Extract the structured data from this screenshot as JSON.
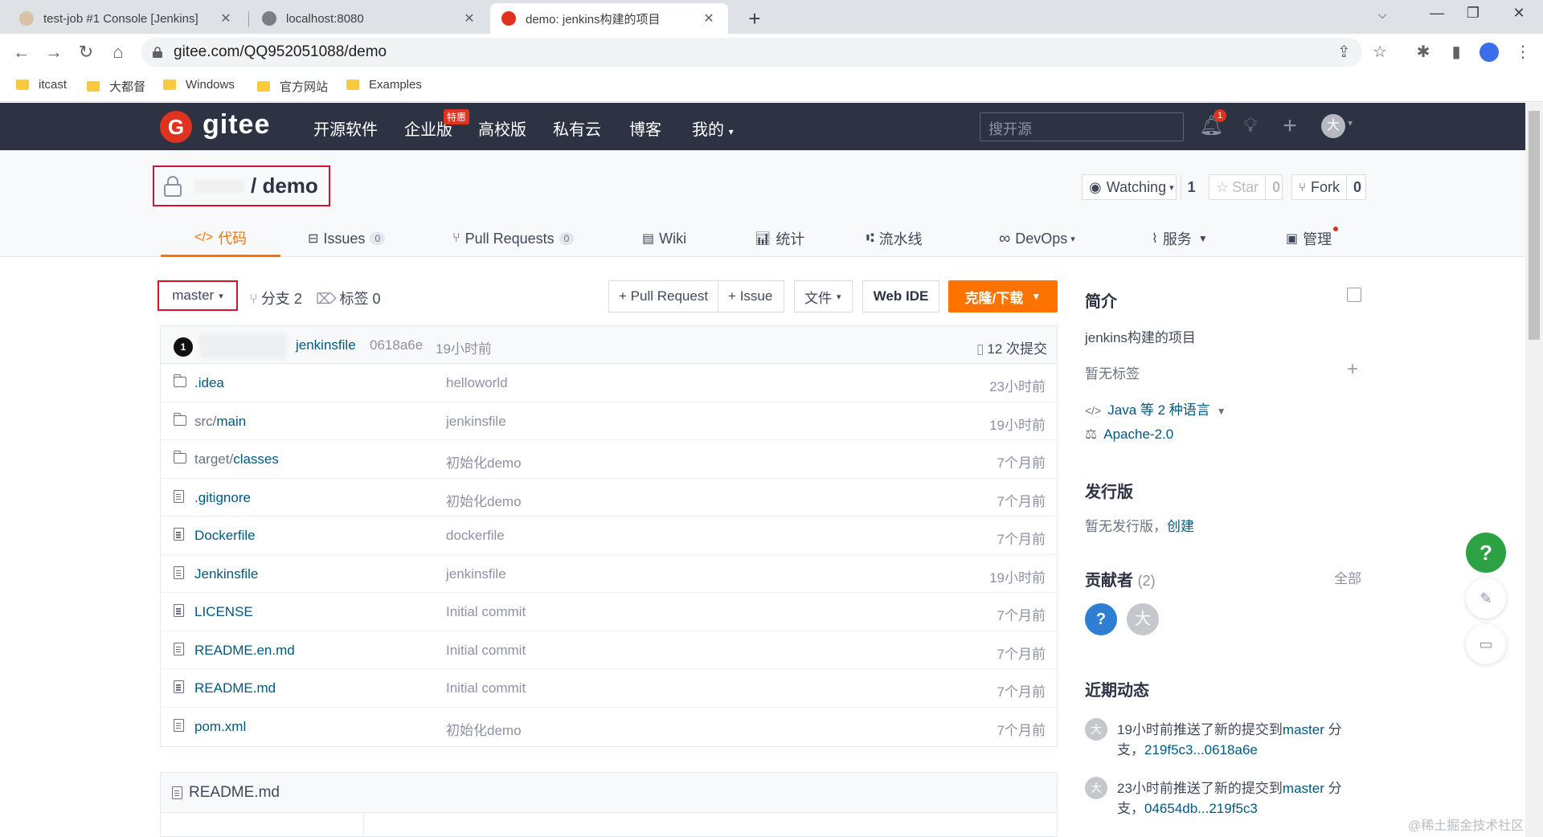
{
  "browser": {
    "tabs": [
      {
        "title": "test-job #1 Console [Jenkins]"
      },
      {
        "title": "localhost:8080"
      },
      {
        "title": "demo: jenkins构建的项目"
      }
    ],
    "url": "gitee.com/QQ952051088/demo",
    "bookmarks": [
      "itcast",
      "大都督",
      "Windows",
      "官方网站",
      "Examples"
    ]
  },
  "gitee": {
    "logo": "gitee",
    "nav": [
      "开源软件",
      "企业版",
      "高校版",
      "私有云",
      "博客",
      "我的"
    ],
    "hot_badge": "特惠",
    "search_placeholder": "搜开源",
    "notif_count": "1",
    "avatar_char": "大"
  },
  "repo": {
    "name": "/ demo",
    "watching_label": "Watching",
    "watching_count": "1",
    "star_label": "Star",
    "star_count": "0",
    "fork_label": "Fork",
    "fork_count": "0",
    "tabs": [
      {
        "label": "代码",
        "count": ""
      },
      {
        "label": "Issues",
        "count": "0"
      },
      {
        "label": "Pull Requests",
        "count": "0"
      },
      {
        "label": "Wiki",
        "count": ""
      },
      {
        "label": "统计",
        "count": ""
      },
      {
        "label": "流水线",
        "count": ""
      },
      {
        "label": "DevOps",
        "count": ""
      },
      {
        "label": "服务",
        "count": ""
      },
      {
        "label": "管理",
        "count": ""
      }
    ]
  },
  "toolbar": {
    "branch": "master",
    "branches": "分支 2",
    "tags": "标签 0",
    "pr_btn": "+ Pull Request",
    "issue_btn": "+ Issue",
    "file_btn": "文件",
    "webide_btn": "Web IDE",
    "clone_btn": "克隆/下载"
  },
  "latest_commit": {
    "avatar": "1",
    "message": "jenkinsfile",
    "hash": "0618a6e",
    "time": "19小时前",
    "count": "12 次提交"
  },
  "files": [
    {
      "dir": "",
      "name": ".idea",
      "msg": "helloworld",
      "time": "23小时前",
      "type": "folder"
    },
    {
      "dir": "src/",
      "name": "main",
      "msg": "jenkinsfile",
      "time": "19小时前",
      "type": "folder"
    },
    {
      "dir": "target/",
      "name": "classes",
      "msg": "初始化demo",
      "time": "7个月前",
      "type": "folder"
    },
    {
      "dir": "",
      "name": ".gitignore",
      "msg": "初始化demo",
      "time": "7个月前",
      "type": "file"
    },
    {
      "dir": "",
      "name": "Dockerfile",
      "msg": "dockerfile",
      "time": "7个月前",
      "type": "file"
    },
    {
      "dir": "",
      "name": "Jenkinsfile",
      "msg": "jenkinsfile",
      "time": "19小时前",
      "type": "file"
    },
    {
      "dir": "",
      "name": "LICENSE",
      "msg": "Initial commit",
      "time": "7个月前",
      "type": "file"
    },
    {
      "dir": "",
      "name": "README.en.md",
      "msg": "Initial commit",
      "time": "7个月前",
      "type": "file"
    },
    {
      "dir": "",
      "name": "README.md",
      "msg": "Initial commit",
      "time": "7个月前",
      "type": "file"
    },
    {
      "dir": "",
      "name": "pom.xml",
      "msg": "初始化demo",
      "time": "7个月前",
      "type": "file"
    }
  ],
  "readme": {
    "title": "README.md"
  },
  "sidebar": {
    "intro_heading": "简介",
    "description": "jenkins构建的项目",
    "no_tags": "暂无标签",
    "language": "Java 等 2 种语言",
    "license": "Apache-2.0",
    "release_heading": "发行版",
    "no_release": "暂无发行版，",
    "create_link": "创建",
    "contrib_heading": "贡献者",
    "contrib_count": "(2)",
    "all_link": "全部",
    "contributors": [
      "?",
      "大"
    ],
    "activity_heading": "近期动态",
    "activities": [
      {
        "prefix": "19小时前推送了新的提交到",
        "branch": "master",
        "mid": "分支，",
        "range": "219f5c3...0618a6e"
      },
      {
        "prefix": "23小时前推送了新的提交到",
        "branch": "master",
        "mid": "分支，",
        "range": "04654db...219f5c3"
      }
    ]
  },
  "colors": {
    "header_bg": "#2d3342",
    "accent_orange": "#fe7300",
    "link": "#005980",
    "highlight_red": "#d3142b",
    "help_green": "#2ca243"
  },
  "watermark": "@稀土掘金技术社区"
}
